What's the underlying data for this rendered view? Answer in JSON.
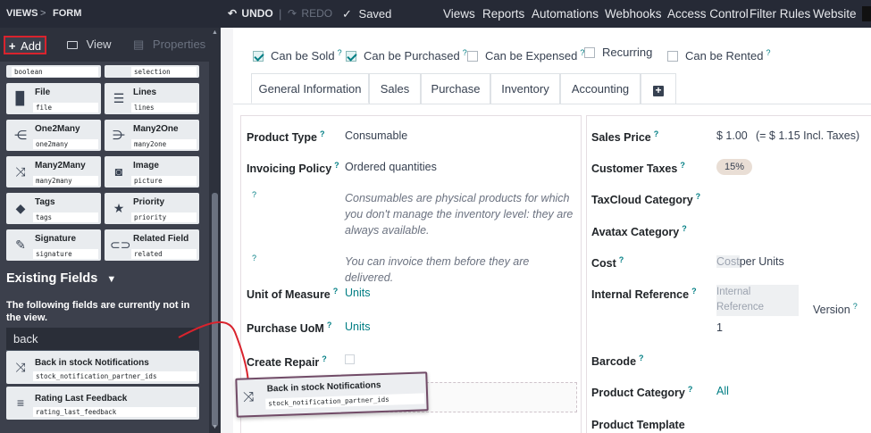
{
  "topbar": {
    "views": "VIEWS",
    "sep": ">",
    "form": "FORM",
    "undo": "UNDO",
    "redo": "REDO",
    "saved": "Saved",
    "menu": [
      "Views",
      "Reports",
      "Automations",
      "Webhooks",
      "Access Control",
      "Filter Rules",
      "Website"
    ]
  },
  "sidebar": {
    "tabs": {
      "add": "Add",
      "view": "View",
      "properties": "Properties"
    },
    "partial_row": [
      {
        "tech": "boolean"
      },
      {
        "tech": "selection"
      }
    ],
    "fields": [
      {
        "name": "File",
        "tech": "file",
        "icon": "file-icon"
      },
      {
        "name": "Lines",
        "tech": "lines",
        "icon": "list-icon"
      },
      {
        "name": "One2Many",
        "tech": "one2many",
        "icon": "one2many-icon"
      },
      {
        "name": "Many2One",
        "tech": "many2one",
        "icon": "many2one-icon"
      },
      {
        "name": "Many2Many",
        "tech": "many2many",
        "icon": "many2many-icon"
      },
      {
        "name": "Image",
        "tech": "picture",
        "icon": "camera-icon"
      },
      {
        "name": "Tags",
        "tech": "tags",
        "icon": "tag-icon"
      },
      {
        "name": "Priority",
        "tech": "priority",
        "icon": "star-icon"
      },
      {
        "name": "Signature",
        "tech": "signature",
        "icon": "signature-icon"
      },
      {
        "name": "Related Field",
        "tech": "related",
        "icon": "link-icon"
      }
    ],
    "existing": {
      "title": "Existing Fields",
      "note": "The following fields are currently not in the view.",
      "search_value": "back",
      "items": [
        {
          "name": "Back in stock Notifications",
          "tech": "stock_notification_partner_ids",
          "icon": "many2many-icon"
        },
        {
          "name": "Rating Last Feedback",
          "tech": "rating_last_feedback",
          "icon": "text-icon"
        }
      ]
    }
  },
  "form": {
    "checkboxes": [
      {
        "label": "Can be Sold",
        "checked": true,
        "help": "?"
      },
      {
        "label": "Can be Purchased",
        "checked": true,
        "help": "?"
      },
      {
        "label": "Can be Expensed",
        "checked": false,
        "help": "?"
      },
      {
        "label": "Recurring",
        "checked": false,
        "help": ""
      },
      {
        "label": "Can be Rented",
        "checked": false,
        "help": "?"
      }
    ],
    "tabs": [
      "General Information",
      "Sales",
      "Purchase",
      "Inventory",
      "Accounting",
      "+"
    ],
    "left": {
      "product_type": {
        "label": "Product Type",
        "value": "Consumable"
      },
      "invoicing_policy": {
        "label": "Invoicing Policy",
        "value": "Ordered quantities"
      },
      "help1": "Consumables are physical products for which you don't manage the inventory level: they are always available.",
      "help2": "You can invoice them before they are delivered.",
      "uom": {
        "label": "Unit of Measure",
        "value": "Units"
      },
      "purchase_uom": {
        "label": "Purchase UoM",
        "value": "Units"
      },
      "create_repair": {
        "label": "Create Repair"
      }
    },
    "right": {
      "sales_price": {
        "label": "Sales Price",
        "value": "$ 1.00",
        "incl": "(= $ 1.15 Incl. Taxes)"
      },
      "customer_taxes": {
        "label": "Customer Taxes",
        "value": "15%"
      },
      "taxcloud": {
        "label": "TaxCloud Category"
      },
      "avatax": {
        "label": "Avatax Category"
      },
      "cost": {
        "label": "Cost",
        "value": "Cost",
        "unit": "per Units"
      },
      "internal_ref": {
        "label": "Internal Reference",
        "placeholder": "Internal Reference",
        "version_label": "Version",
        "version_value": "1"
      },
      "barcode": {
        "label": "Barcode"
      },
      "product_category": {
        "label": "Product Category",
        "value": "All"
      },
      "product_template": {
        "label": "Product Template"
      }
    },
    "drag_ghost": {
      "name": "Back in stock Notifications",
      "tech": "stock_notification_partner_ids"
    }
  },
  "colors": {
    "accent": "#017e84",
    "topbar": "#262a36",
    "sidebar": "#3c404c",
    "highlight": "#d9232d",
    "ghost_border": "#714b67"
  }
}
